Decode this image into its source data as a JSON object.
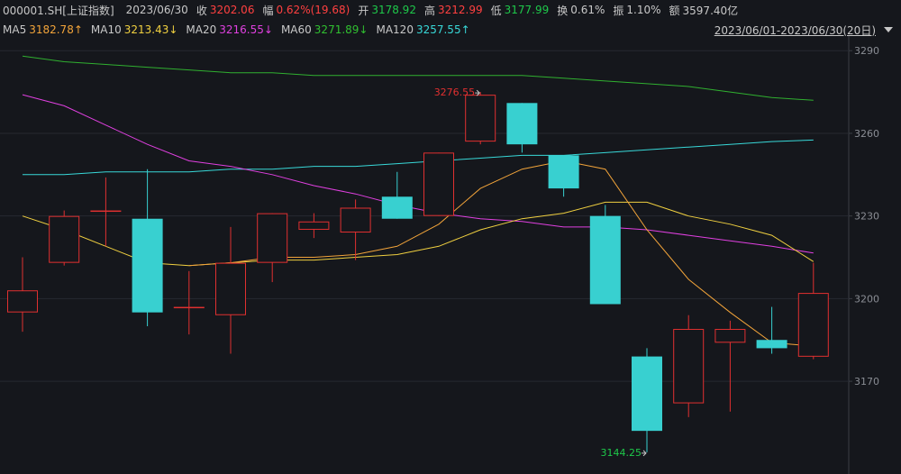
{
  "header": {
    "code": "000001.SH[上证指数]",
    "date": "2023/06/30",
    "close_label": "收",
    "close": "3202.06",
    "change_label": "幅",
    "change": "0.62%(19.68)",
    "open_label": "开",
    "open": "3178.92",
    "high_label": "高",
    "high": "3212.99",
    "low_label": "低",
    "low": "3177.99",
    "turnover_label": "换",
    "turnover": "0.61%",
    "amplitude_label": "振",
    "amplitude": "1.10%",
    "amount_label": "额",
    "amount": "3597.40亿"
  },
  "ma_bar": {
    "ma5_label": "MA5",
    "ma5": "3182.78↑",
    "ma10_label": "MA10",
    "ma10": "3213.43↓",
    "ma20_label": "MA20",
    "ma20": "3216.55↓",
    "ma60_label": "MA60",
    "ma60": "3271.89↓",
    "ma120_label": "MA120",
    "ma120": "3257.55↑",
    "range": "2023/06/01-2023/06/30(20日)",
    "range_icon": "chevron-down-icon"
  },
  "colors": {
    "up": "#e03030",
    "down": "#38d0d0",
    "ma5": "#f2a43a",
    "ma10": "#f0d040",
    "ma20": "#e040e0",
    "ma60": "#30b030",
    "ma120": "#38d8d8"
  },
  "chart_data": {
    "type": "candlestick",
    "ylim": [
      3137,
      3294
    ],
    "yticks": [
      3170,
      3200,
      3230,
      3260,
      3290
    ],
    "candles": [
      {
        "o": 3195,
        "c": 3203,
        "h": 3215,
        "l": 3188
      },
      {
        "o": 3213,
        "c": 3230,
        "h": 3232,
        "l": 3212
      },
      {
        "o": 3232,
        "c": 3232,
        "h": 3244,
        "l": 3219
      },
      {
        "o": 3229,
        "c": 3195,
        "h": 3247,
        "l": 3190
      },
      {
        "o": 3197,
        "c": 3197,
        "h": 3210,
        "l": 3187
      },
      {
        "o": 3194,
        "c": 3213,
        "h": 3226,
        "l": 3180
      },
      {
        "o": 3213,
        "c": 3231,
        "h": 3231,
        "l": 3206
      },
      {
        "o": 3225,
        "c": 3228,
        "h": 3231,
        "l": 3222
      },
      {
        "o": 3224,
        "c": 3233,
        "h": 3236,
        "l": 3214
      },
      {
        "o": 3237,
        "c": 3229,
        "h": 3246,
        "l": 3229
      },
      {
        "o": 3230,
        "c": 3253,
        "h": 3253,
        "l": 3230
      },
      {
        "o": 3257,
        "c": 3274,
        "h": 3275,
        "l": 3256
      },
      {
        "o": 3271,
        "c": 3256,
        "h": 3271,
        "l": 3253
      },
      {
        "o": 3252,
        "c": 3240,
        "h": 3252,
        "l": 3237
      },
      {
        "o": 3230,
        "c": 3198,
        "h": 3234,
        "l": 3198
      },
      {
        "o": 3179,
        "c": 3152,
        "h": 3182,
        "l": 3144.25
      },
      {
        "o": 3162,
        "c": 3189,
        "h": 3194,
        "l": 3157
      },
      {
        "o": 3184,
        "c": 3189,
        "h": 3192,
        "l": 3159
      },
      {
        "o": 3185,
        "c": 3182,
        "h": 3197,
        "l": 3180
      },
      {
        "o": 3178.92,
        "c": 3202.06,
        "h": 3212.99,
        "l": 3177.99
      }
    ],
    "ma5": [
      null,
      null,
      null,
      null,
      3212,
      3213,
      3215,
      3215,
      3216,
      3219,
      3227,
      3240,
      3247,
      3250,
      3247,
      3225,
      3207,
      3195,
      3184,
      3182.78
    ],
    "ma10": [
      3230,
      3225,
      3219,
      3213,
      3212,
      3213,
      3214,
      3214,
      3215,
      3216,
      3219,
      3225,
      3229,
      3231,
      3235,
      3235,
      3230,
      3227,
      3223,
      3213.43
    ],
    "ma20": [
      3274,
      3270,
      3263,
      3256,
      3250,
      3248,
      3245,
      3241,
      3238,
      3234,
      3231,
      3229,
      3228,
      3226,
      3226,
      3225,
      3223,
      3221,
      3219,
      3216.55
    ],
    "ma60": [
      3288,
      3286,
      3285,
      3284,
      3283,
      3282,
      3282,
      3281,
      3281,
      3281,
      3281,
      3281,
      3281,
      3280,
      3279,
      3278,
      3277,
      3275,
      3273,
      3272
    ],
    "ma120": [
      3245,
      3245,
      3246,
      3246,
      3246,
      3247,
      3247,
      3248,
      3248,
      3249,
      3250,
      3251,
      3252,
      3252,
      3253,
      3254,
      3255,
      3256,
      3257,
      3257.55
    ],
    "high_marker": "3276.55",
    "low_marker": "3144.25"
  }
}
